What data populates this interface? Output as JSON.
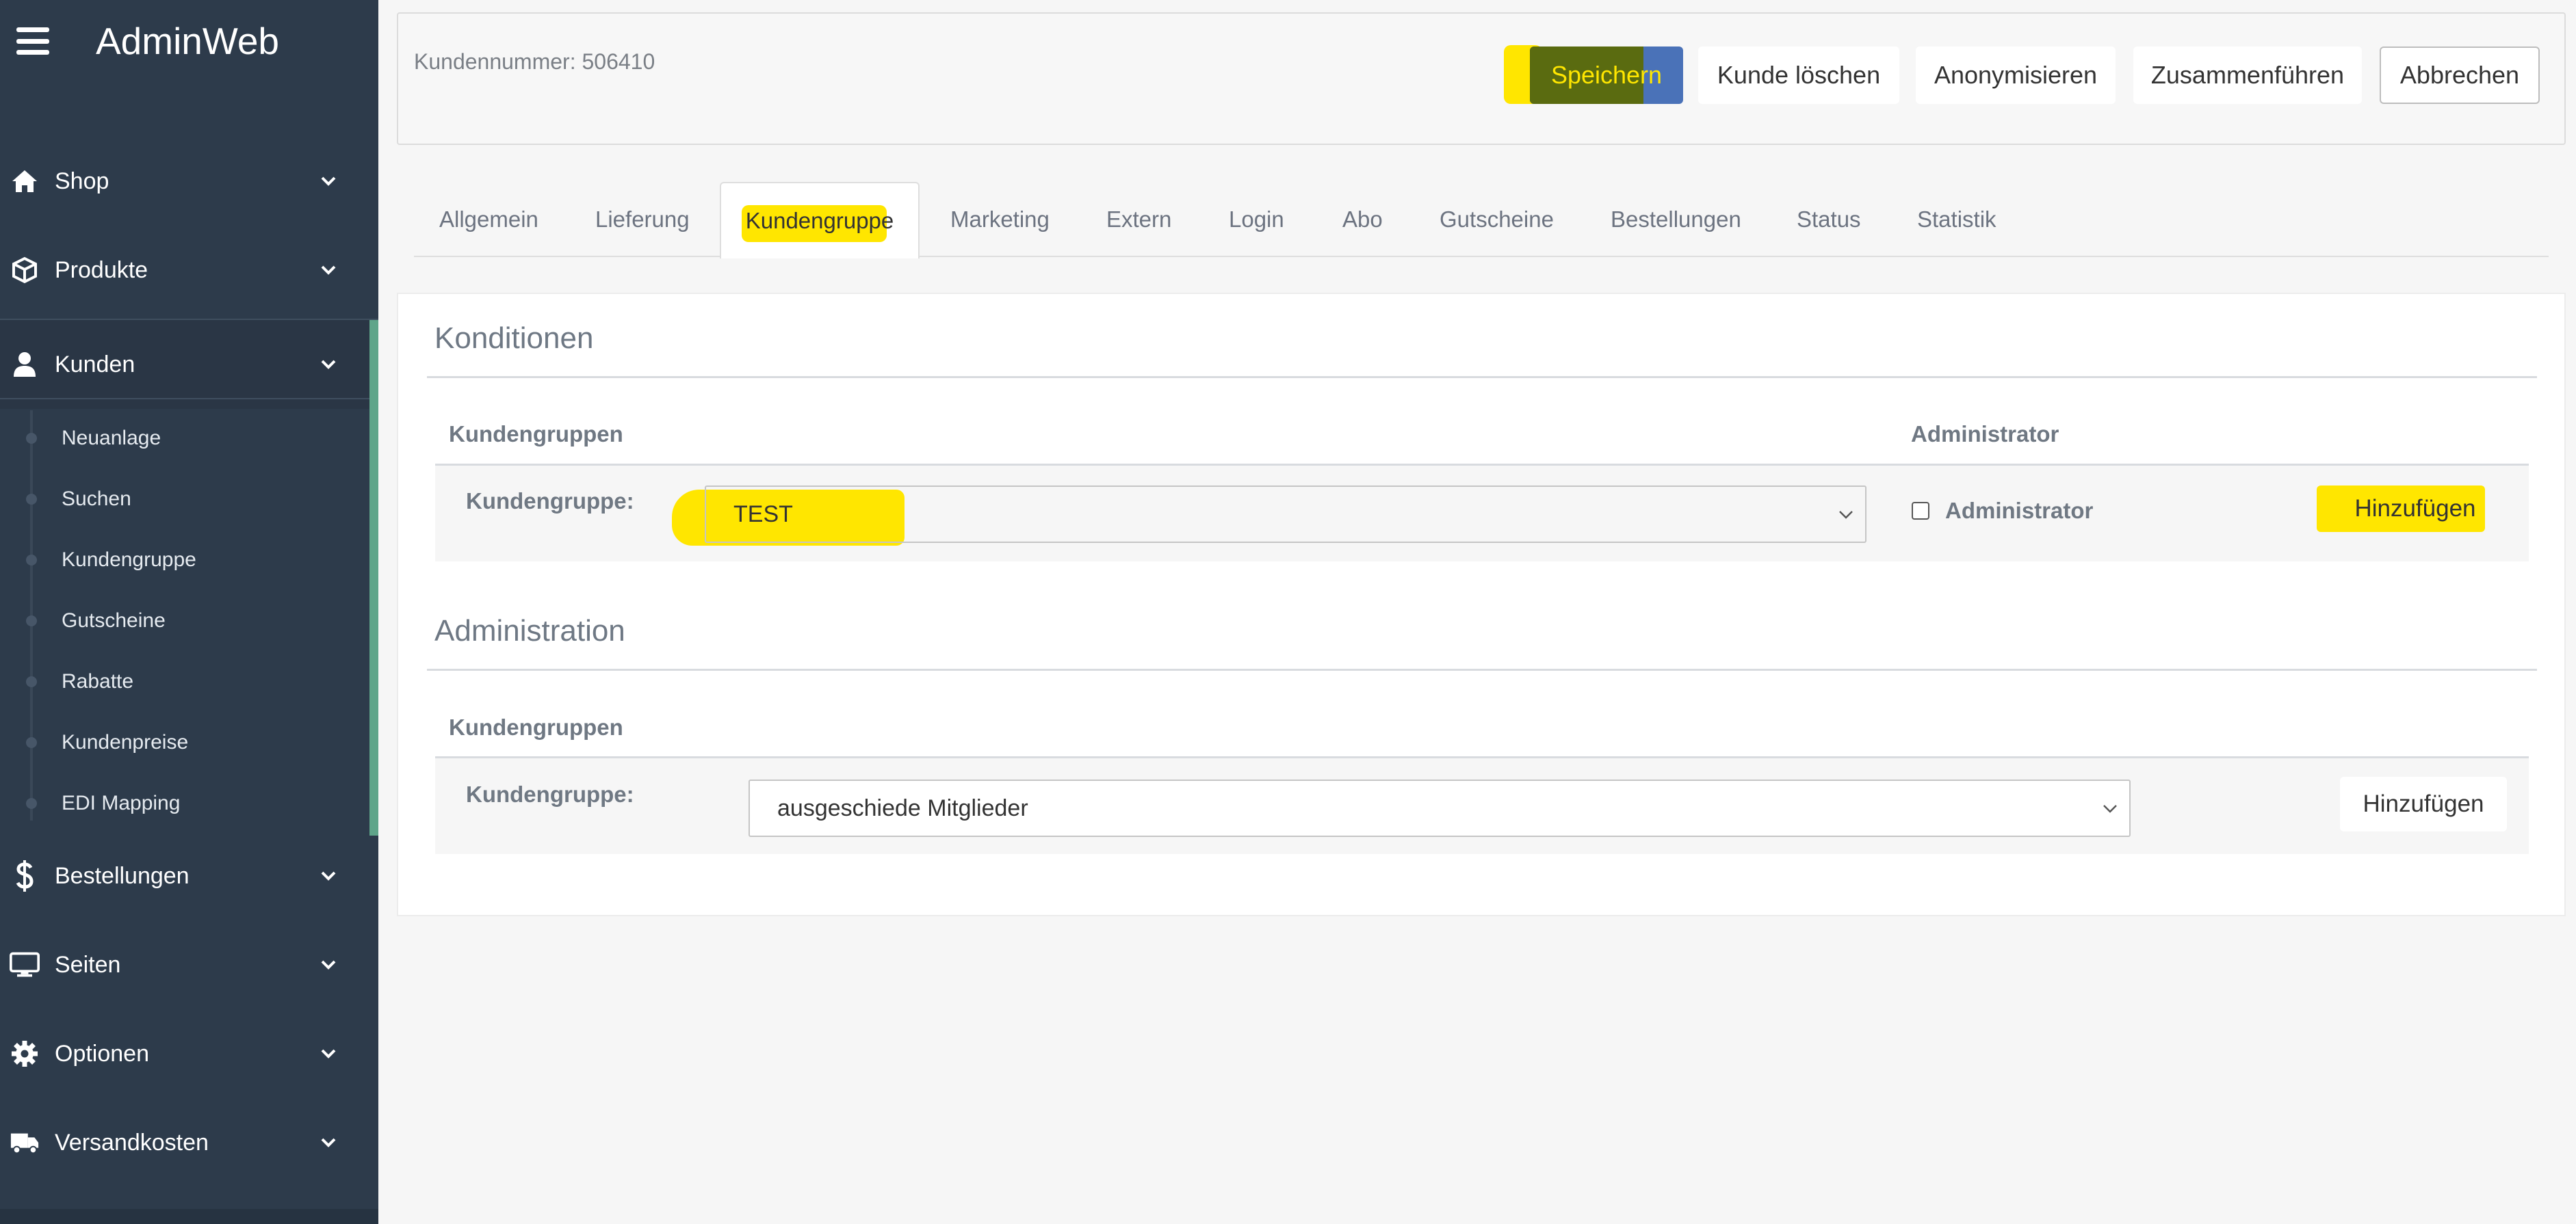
{
  "app": {
    "title": "AdminWeb"
  },
  "sidebar": {
    "items": [
      {
        "label": "Shop",
        "icon": "home-icon"
      },
      {
        "label": "Produkte",
        "icon": "cube-icon"
      },
      {
        "label": "Kunden",
        "icon": "user-icon"
      },
      {
        "label": "Bestellungen",
        "icon": "dollar-icon"
      },
      {
        "label": "Seiten",
        "icon": "monitor-icon"
      },
      {
        "label": "Optionen",
        "icon": "gear-icon"
      },
      {
        "label": "Versandkosten",
        "icon": "truck-icon"
      }
    ],
    "submenu": [
      "Neuanlage",
      "Suchen",
      "Kundengruppe",
      "Gutscheine",
      "Rabatte",
      "Kundenpreise",
      "EDI Mapping"
    ]
  },
  "header": {
    "customer_number": "Kundennummer: 506410",
    "buttons": {
      "save": "Speichern",
      "delete": "Kunde löschen",
      "anonymize": "Anonymisieren",
      "merge": "Zusammenführen",
      "cancel": "Abbrechen"
    }
  },
  "tabs": [
    "Allgemein",
    "Lieferung",
    "Kundengruppe",
    "Marketing",
    "Extern",
    "Login",
    "Abo",
    "Gutscheine",
    "Bestellungen",
    "Status",
    "Statistik"
  ],
  "active_tab": "Kundengruppe",
  "konditionen": {
    "title": "Konditionen",
    "col_groups": "Kundengruppen",
    "col_admin": "Administrator",
    "row_label": "Kundengruppe:",
    "selected": "TEST",
    "checkbox_label": "Administrator",
    "add_label": "Hinzufügen"
  },
  "administration": {
    "title": "Administration",
    "col_groups": "Kundengruppen",
    "row_label": "Kundengruppe:",
    "selected": "ausgeschiede Mitglieder",
    "add_label": "Hinzufügen"
  },
  "colors": {
    "sidebar_bg": "#2d3b4b",
    "primary": "#4a72b8",
    "accent": "#5fa58a",
    "highlight": "#ffe600"
  }
}
